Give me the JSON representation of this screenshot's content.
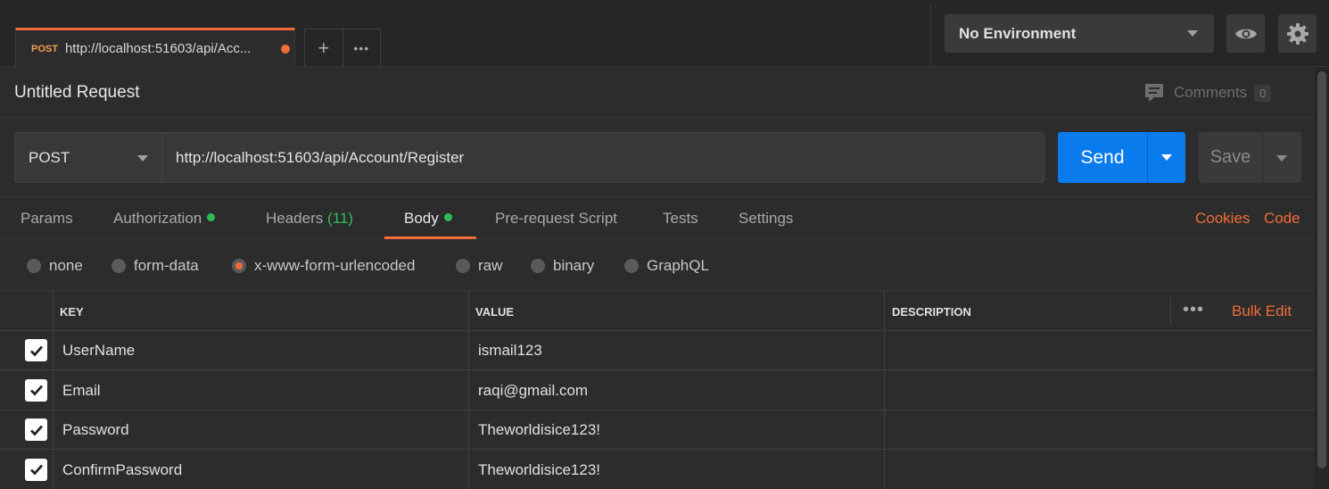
{
  "tab": {
    "method": "POST",
    "url": "http://localhost:51603/api/Acc...",
    "unsaved_dot": true
  },
  "tab_actions": {
    "new_tab": "+",
    "more": "•••"
  },
  "environment": {
    "selected": "No Environment"
  },
  "request": {
    "title": "Untitled Request",
    "comments_label": "Comments",
    "comments_count": "0",
    "method": "POST",
    "url": "http://localhost:51603/api/Account/Register",
    "send_label": "Send",
    "save_label": "Save"
  },
  "request_tabs": {
    "params": "Params",
    "authorization": "Authorization",
    "headers": "Headers",
    "headers_count": "(11)",
    "body": "Body",
    "prerequest": "Pre-request Script",
    "tests": "Tests",
    "settings": "Settings",
    "cookies": "Cookies",
    "code": "Code",
    "active": "Body"
  },
  "body_types": {
    "none": "none",
    "form_data": "form-data",
    "urlencoded": "x-www-form-urlencoded",
    "raw": "raw",
    "binary": "binary",
    "graphql": "GraphQL",
    "selected": "x-www-form-urlencoded"
  },
  "table": {
    "headers": {
      "key": "KEY",
      "value": "VALUE",
      "description": "DESCRIPTION"
    },
    "more": "•••",
    "bulk_edit": "Bulk Edit",
    "rows": [
      {
        "checked": true,
        "key": "UserName",
        "value": "ismail123",
        "description": ""
      },
      {
        "checked": true,
        "key": "Email",
        "value": "raqi@gmail.com",
        "description": ""
      },
      {
        "checked": true,
        "key": "Password",
        "value": "Theworldisice123!",
        "description": ""
      },
      {
        "checked": true,
        "key": "ConfirmPassword",
        "value": "Theworldisice123!",
        "description": ""
      }
    ]
  },
  "colors": {
    "accent": "#f26b3a",
    "send": "#097bed",
    "green": "#2ebd59"
  }
}
